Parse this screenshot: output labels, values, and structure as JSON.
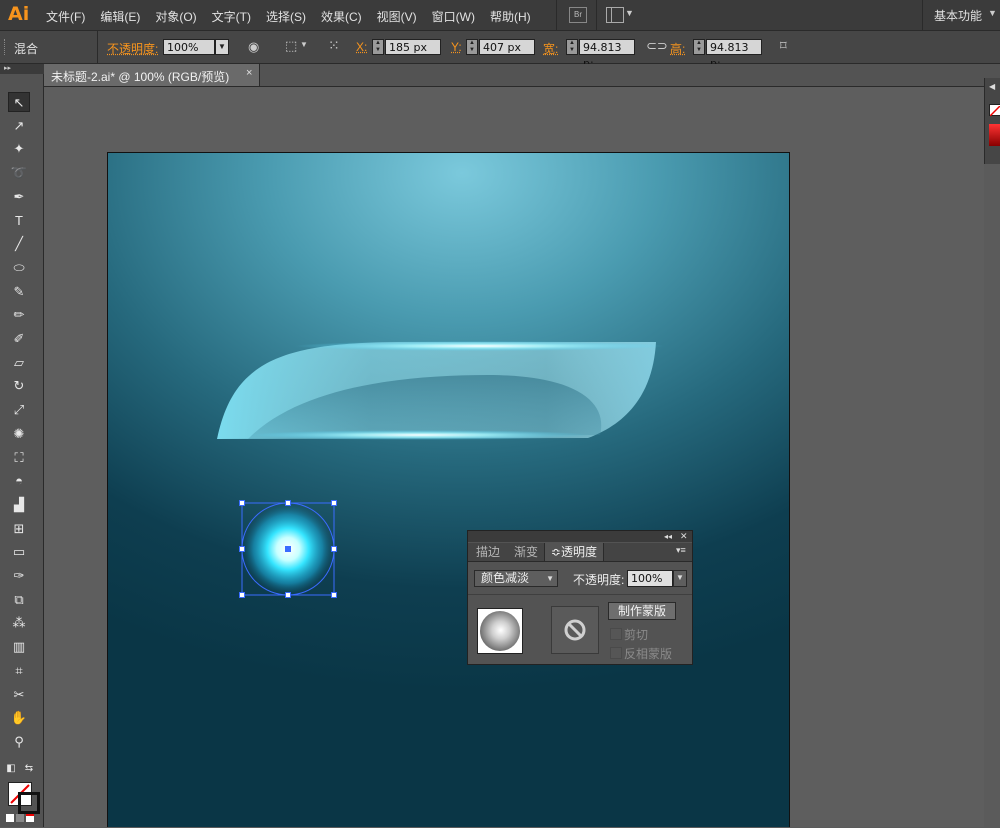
{
  "app": {
    "logo": "Ai"
  },
  "menu": {
    "items": [
      "文件(F)",
      "编辑(E)",
      "对象(O)",
      "文字(T)",
      "选择(S)",
      "效果(C)",
      "视图(V)",
      "窗口(W)",
      "帮助(H)"
    ],
    "bridge_label": "Br",
    "workspace": "基本功能"
  },
  "control": {
    "mode": "混合",
    "opacity_label": "不透明度:",
    "opacity_value": "100%",
    "x_label": "X:",
    "x_value": "185 px",
    "y_label": "Y:",
    "y_value": "407 px",
    "w_label": "宽:",
    "w_value": "94.813 p:",
    "h_label": "高:",
    "h_value": "94.813 p:"
  },
  "document_tab": {
    "title": "未标题-2.ai* @ 100% (RGB/预览)",
    "close": "×"
  },
  "tools": [
    {
      "name": "selection-tool-icon",
      "glyph": "↖"
    },
    {
      "name": "direct-selection-tool-icon",
      "glyph": "↗"
    },
    {
      "name": "magic-wand-tool-icon",
      "glyph": "✦"
    },
    {
      "name": "lasso-tool-icon",
      "glyph": "➰"
    },
    {
      "name": "pen-tool-icon",
      "glyph": "✒"
    },
    {
      "name": "type-tool-icon",
      "glyph": "T"
    },
    {
      "name": "line-tool-icon",
      "glyph": "╱"
    },
    {
      "name": "ellipse-tool-icon",
      "glyph": "⬭"
    },
    {
      "name": "paintbrush-tool-icon",
      "glyph": "✎"
    },
    {
      "name": "pencil-tool-icon",
      "glyph": "✏"
    },
    {
      "name": "blob-brush-tool-icon",
      "glyph": "✐"
    },
    {
      "name": "eraser-tool-icon",
      "glyph": "▱"
    },
    {
      "name": "rotate-tool-icon",
      "glyph": "↻"
    },
    {
      "name": "scale-tool-icon",
      "glyph": "⤢"
    },
    {
      "name": "warp-tool-icon",
      "glyph": "✺"
    },
    {
      "name": "free-transform-tool-icon",
      "glyph": "⛶"
    },
    {
      "name": "shape-builder-tool-icon",
      "glyph": "◓"
    },
    {
      "name": "perspective-grid-tool-icon",
      "glyph": "▟"
    },
    {
      "name": "mesh-tool-icon",
      "glyph": "⊞"
    },
    {
      "name": "gradient-tool-icon",
      "glyph": "▭"
    },
    {
      "name": "eyedropper-tool-icon",
      "glyph": "✑"
    },
    {
      "name": "blend-tool-icon",
      "glyph": "⧉"
    },
    {
      "name": "symbol-sprayer-tool-icon",
      "glyph": "⁂"
    },
    {
      "name": "column-graph-tool-icon",
      "glyph": "▥"
    },
    {
      "name": "artboard-tool-icon",
      "glyph": "⌗"
    },
    {
      "name": "slice-tool-icon",
      "glyph": "✂"
    },
    {
      "name": "hand-tool-icon",
      "glyph": "✋"
    },
    {
      "name": "zoom-tool-icon",
      "glyph": "⚲"
    }
  ],
  "panel": {
    "tabs": [
      "描边",
      "渐变",
      "≎透明度"
    ],
    "blend_mode": "颜色减淡",
    "opacity_label": "不透明度:",
    "opacity_value": "100%",
    "make_mask": "制作蒙版",
    "clip": "剪切",
    "invert_mask": "反相蒙版"
  },
  "colors": {
    "accent": "#f7941d",
    "selection": "#3a6cff"
  }
}
